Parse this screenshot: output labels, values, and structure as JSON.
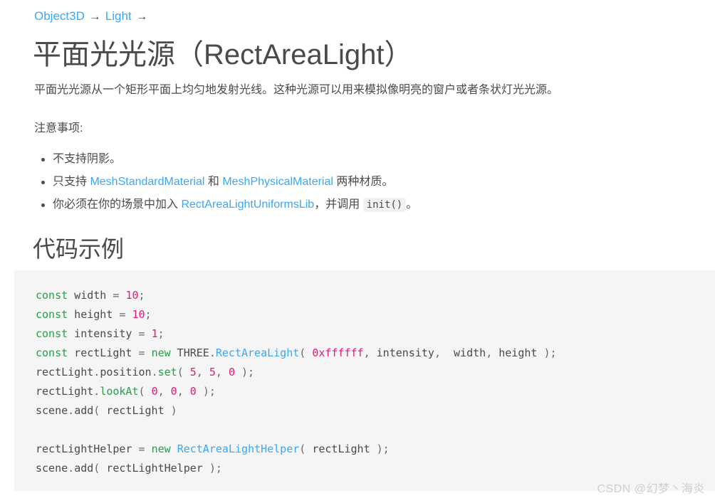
{
  "breadcrumb": {
    "items": [
      {
        "label": "Object3D",
        "arrow": "→"
      },
      {
        "label": "Light",
        "arrow": "→"
      }
    ],
    "link_color": "#3ba7f5"
  },
  "page_title": "平面光光源（RectAreaLight）",
  "intro": "平面光光源从一个矩形平面上均匀地发射光线。这种光源可以用来模拟像明亮的窗户或者条状灯光光源。",
  "notes": {
    "label": "注意事项:",
    "items": [
      {
        "parts": [
          {
            "type": "text",
            "text": "不支持阴影。"
          }
        ]
      },
      {
        "parts": [
          {
            "type": "text",
            "text": "只支持 "
          },
          {
            "type": "link",
            "text": "MeshStandardMaterial"
          },
          {
            "type": "text",
            "text": " 和 "
          },
          {
            "type": "link",
            "text": "MeshPhysicalMaterial"
          },
          {
            "type": "text",
            "text": " 两种材质。"
          }
        ]
      },
      {
        "parts": [
          {
            "type": "text",
            "text": "你必须在你的场景中加入 "
          },
          {
            "type": "link",
            "text": "RectAreaLightUniformsLib"
          },
          {
            "type": "text",
            "text": "，并调用 "
          },
          {
            "type": "code",
            "text": "init()"
          },
          {
            "type": "text",
            "text": "。"
          }
        ]
      }
    ]
  },
  "section_heading": "代码示例",
  "code": {
    "language": "javascript",
    "background": "#f5f5f5",
    "plain_text": "const width = 10;\nconst height = 10;\nconst intensity = 1;\nconst rectLight = new THREE.RectAreaLight( 0xffffff, intensity,  width, height );\nrectLight.position.set( 5, 5, 0 );\nrectLight.lookAt( 0, 0, 0 );\nscene.add( rectLight )\n\nrectLightHelper = new RectAreaLightHelper( rectLight );\nscene.add( rectLightHelper );",
    "lines": [
      [
        {
          "t": "kw",
          "s": "const"
        },
        {
          "t": "plain",
          "s": " width "
        },
        {
          "t": "punc",
          "s": "="
        },
        {
          "t": "plain",
          "s": " "
        },
        {
          "t": "num",
          "s": "10"
        },
        {
          "t": "punc",
          "s": ";"
        }
      ],
      [
        {
          "t": "kw",
          "s": "const"
        },
        {
          "t": "plain",
          "s": " height "
        },
        {
          "t": "punc",
          "s": "="
        },
        {
          "t": "plain",
          "s": " "
        },
        {
          "t": "num",
          "s": "10"
        },
        {
          "t": "punc",
          "s": ";"
        }
      ],
      [
        {
          "t": "kw",
          "s": "const"
        },
        {
          "t": "plain",
          "s": " intensity "
        },
        {
          "t": "punc",
          "s": "="
        },
        {
          "t": "plain",
          "s": " "
        },
        {
          "t": "num",
          "s": "1"
        },
        {
          "t": "punc",
          "s": ";"
        }
      ],
      [
        {
          "t": "kw",
          "s": "const"
        },
        {
          "t": "plain",
          "s": " rectLight "
        },
        {
          "t": "punc",
          "s": "="
        },
        {
          "t": "plain",
          "s": " "
        },
        {
          "t": "kw",
          "s": "new"
        },
        {
          "t": "plain",
          "s": " THREE"
        },
        {
          "t": "punc",
          "s": "."
        },
        {
          "t": "cls",
          "s": "RectAreaLight"
        },
        {
          "t": "punc",
          "s": "("
        },
        {
          "t": "plain",
          "s": " "
        },
        {
          "t": "num",
          "s": "0xffffff"
        },
        {
          "t": "punc",
          "s": ","
        },
        {
          "t": "plain",
          "s": " intensity"
        },
        {
          "t": "punc",
          "s": ","
        },
        {
          "t": "plain",
          "s": "  width"
        },
        {
          "t": "punc",
          "s": ","
        },
        {
          "t": "plain",
          "s": " height "
        },
        {
          "t": "punc",
          "s": ");"
        }
      ],
      [
        {
          "t": "plain",
          "s": "rectLight"
        },
        {
          "t": "punc",
          "s": "."
        },
        {
          "t": "plain",
          "s": "position"
        },
        {
          "t": "punc",
          "s": "."
        },
        {
          "t": "fn",
          "s": "set"
        },
        {
          "t": "punc",
          "s": "("
        },
        {
          "t": "plain",
          "s": " "
        },
        {
          "t": "num",
          "s": "5"
        },
        {
          "t": "punc",
          "s": ","
        },
        {
          "t": "plain",
          "s": " "
        },
        {
          "t": "num",
          "s": "5"
        },
        {
          "t": "punc",
          "s": ","
        },
        {
          "t": "plain",
          "s": " "
        },
        {
          "t": "num",
          "s": "0"
        },
        {
          "t": "plain",
          "s": " "
        },
        {
          "t": "punc",
          "s": ");"
        }
      ],
      [
        {
          "t": "plain",
          "s": "rectLight"
        },
        {
          "t": "punc",
          "s": "."
        },
        {
          "t": "fn",
          "s": "lookAt"
        },
        {
          "t": "punc",
          "s": "("
        },
        {
          "t": "plain",
          "s": " "
        },
        {
          "t": "num",
          "s": "0"
        },
        {
          "t": "punc",
          "s": ","
        },
        {
          "t": "plain",
          "s": " "
        },
        {
          "t": "num",
          "s": "0"
        },
        {
          "t": "punc",
          "s": ","
        },
        {
          "t": "plain",
          "s": " "
        },
        {
          "t": "num",
          "s": "0"
        },
        {
          "t": "plain",
          "s": " "
        },
        {
          "t": "punc",
          "s": ");"
        }
      ],
      [
        {
          "t": "plain",
          "s": "scene"
        },
        {
          "t": "punc",
          "s": "."
        },
        {
          "t": "plain",
          "s": "add"
        },
        {
          "t": "punc",
          "s": "("
        },
        {
          "t": "plain",
          "s": " rectLight "
        },
        {
          "t": "punc",
          "s": ")"
        }
      ],
      [],
      [
        {
          "t": "plain",
          "s": "rectLightHelper "
        },
        {
          "t": "punc",
          "s": "="
        },
        {
          "t": "plain",
          "s": " "
        },
        {
          "t": "kw",
          "s": "new"
        },
        {
          "t": "plain",
          "s": " "
        },
        {
          "t": "cls",
          "s": "RectAreaLightHelper"
        },
        {
          "t": "punc",
          "s": "("
        },
        {
          "t": "plain",
          "s": " rectLight "
        },
        {
          "t": "punc",
          "s": ");"
        }
      ],
      [
        {
          "t": "plain",
          "s": "scene"
        },
        {
          "t": "punc",
          "s": "."
        },
        {
          "t": "plain",
          "s": "add"
        },
        {
          "t": "punc",
          "s": "("
        },
        {
          "t": "plain",
          "s": " rectLightHelper "
        },
        {
          "t": "punc",
          "s": ");"
        }
      ]
    ],
    "colors": {
      "keyword": "#25a048",
      "number": "#e5187a",
      "class": "#3ba7f5",
      "function": "#25a048",
      "plain": "#4a4a4a"
    }
  },
  "watermark": "CSDN @幻梦丶海炎"
}
